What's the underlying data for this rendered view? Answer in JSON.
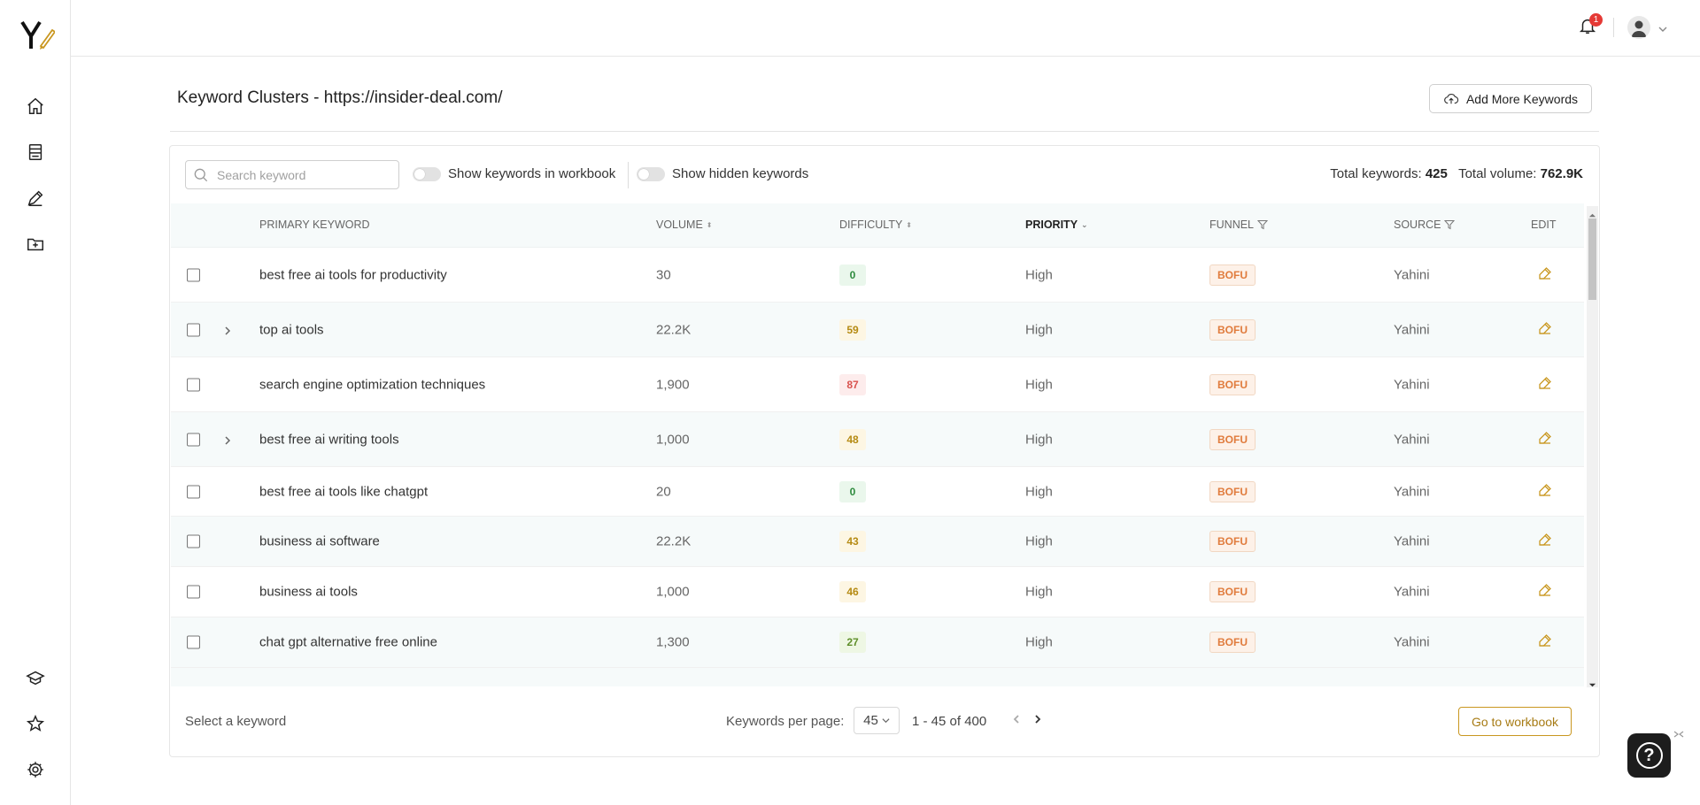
{
  "sidebar": {
    "logo": "Y",
    "items": [
      {
        "icon": "home-icon"
      },
      {
        "icon": "document-icon"
      },
      {
        "icon": "pen-icon"
      },
      {
        "icon": "folder-plus-icon"
      }
    ],
    "bottom_items": [
      {
        "icon": "graduation-cap-icon"
      },
      {
        "icon": "star-icon"
      },
      {
        "icon": "gear-icon"
      }
    ]
  },
  "topbar": {
    "notification_count": "1"
  },
  "header": {
    "title": "Keyword Clusters - https://insider-deal.com/",
    "add_button_label": "Add More Keywords"
  },
  "toolbar": {
    "search_placeholder": "Search keyword",
    "toggle_workbook_label": "Show keywords in workbook",
    "toggle_hidden_label": "Show hidden keywords",
    "total_keywords_label": "Total keywords:",
    "total_keywords_value": "425",
    "total_volume_label": "Total volume:",
    "total_volume_value": "762.9K"
  },
  "table": {
    "columns": {
      "keyword": "PRIMARY KEYWORD",
      "volume": "VOLUME",
      "difficulty": "DIFFICULTY",
      "priority": "PRIORITY",
      "funnel": "FUNNEL",
      "source": "SOURCE",
      "edit": "EDIT"
    },
    "rows": [
      {
        "keyword": "best free ai tools for productivity",
        "volume": "30",
        "difficulty": "0",
        "priority": "High",
        "funnel": "BOFU",
        "source": "Yahini",
        "expandable": false
      },
      {
        "keyword": "top ai tools",
        "volume": "22.2K",
        "difficulty": "59",
        "priority": "High",
        "funnel": "BOFU",
        "source": "Yahini",
        "expandable": true
      },
      {
        "keyword": "search engine optimization techniques",
        "volume": "1,900",
        "difficulty": "87",
        "priority": "High",
        "funnel": "BOFU",
        "source": "Yahini",
        "expandable": false
      },
      {
        "keyword": "best free ai writing tools",
        "volume": "1,000",
        "difficulty": "48",
        "priority": "High",
        "funnel": "BOFU",
        "source": "Yahini",
        "expandable": true
      },
      {
        "keyword": "best free ai tools like chatgpt",
        "volume": "20",
        "difficulty": "0",
        "priority": "High",
        "funnel": "BOFU",
        "source": "Yahini",
        "expandable": false
      },
      {
        "keyword": "business ai software",
        "volume": "22.2K",
        "difficulty": "43",
        "priority": "High",
        "funnel": "BOFU",
        "source": "Yahini",
        "expandable": false
      },
      {
        "keyword": "business ai tools",
        "volume": "1,000",
        "difficulty": "46",
        "priority": "High",
        "funnel": "BOFU",
        "source": "Yahini",
        "expandable": false
      },
      {
        "keyword": "chat gpt alternative free online",
        "volume": "1,300",
        "difficulty": "27",
        "priority": "High",
        "funnel": "BOFU",
        "source": "Yahini",
        "expandable": false
      }
    ]
  },
  "footer": {
    "select_label": "Select a keyword",
    "per_page_label": "Keywords per page:",
    "per_page_value": "45",
    "range_label": "1 - 45 of 400",
    "goto_label": "Go to workbook"
  },
  "help": {
    "label": "?"
  }
}
